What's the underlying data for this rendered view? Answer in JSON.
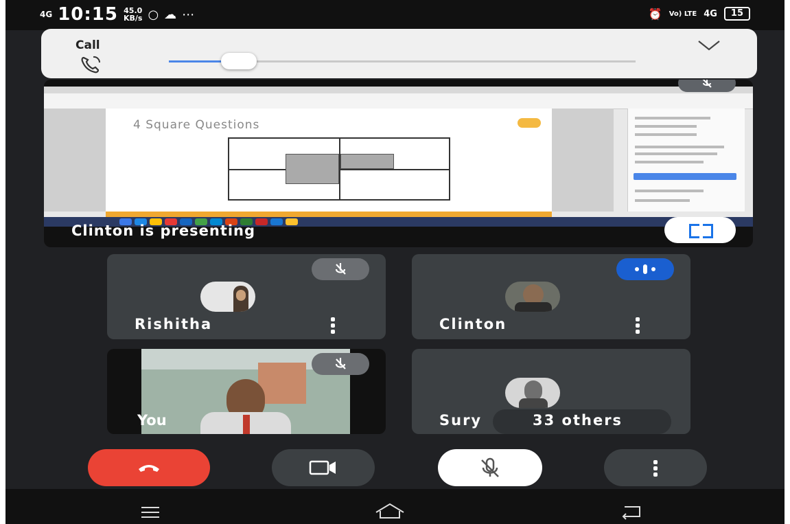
{
  "status_bar": {
    "signal": "4G",
    "time": "10:15",
    "speed_value": "45.0",
    "speed_unit": "KB/s",
    "network": "Vo) LTE",
    "network2": "4G",
    "battery": "15"
  },
  "call_notification": {
    "label": "Call",
    "volume_fraction": 0.15
  },
  "presentation": {
    "doc_title": "4 Square Questions",
    "presenter_label": "Clinton is presenting"
  },
  "participants": [
    {
      "name": "Rishitha",
      "muted": true
    },
    {
      "name": "Clinton",
      "speaking": true
    },
    {
      "name": "You",
      "muted": true
    },
    {
      "name": "Sury"
    }
  ],
  "others_label": "33 others",
  "controls": {
    "end_call": "end-call",
    "camera": "camera",
    "mic": "mic-muted",
    "more": "more-options"
  },
  "colors": {
    "end_call": "#ea4335",
    "speaking": "#1a5fd0",
    "background": "#202124",
    "tile": "#3c4043"
  }
}
